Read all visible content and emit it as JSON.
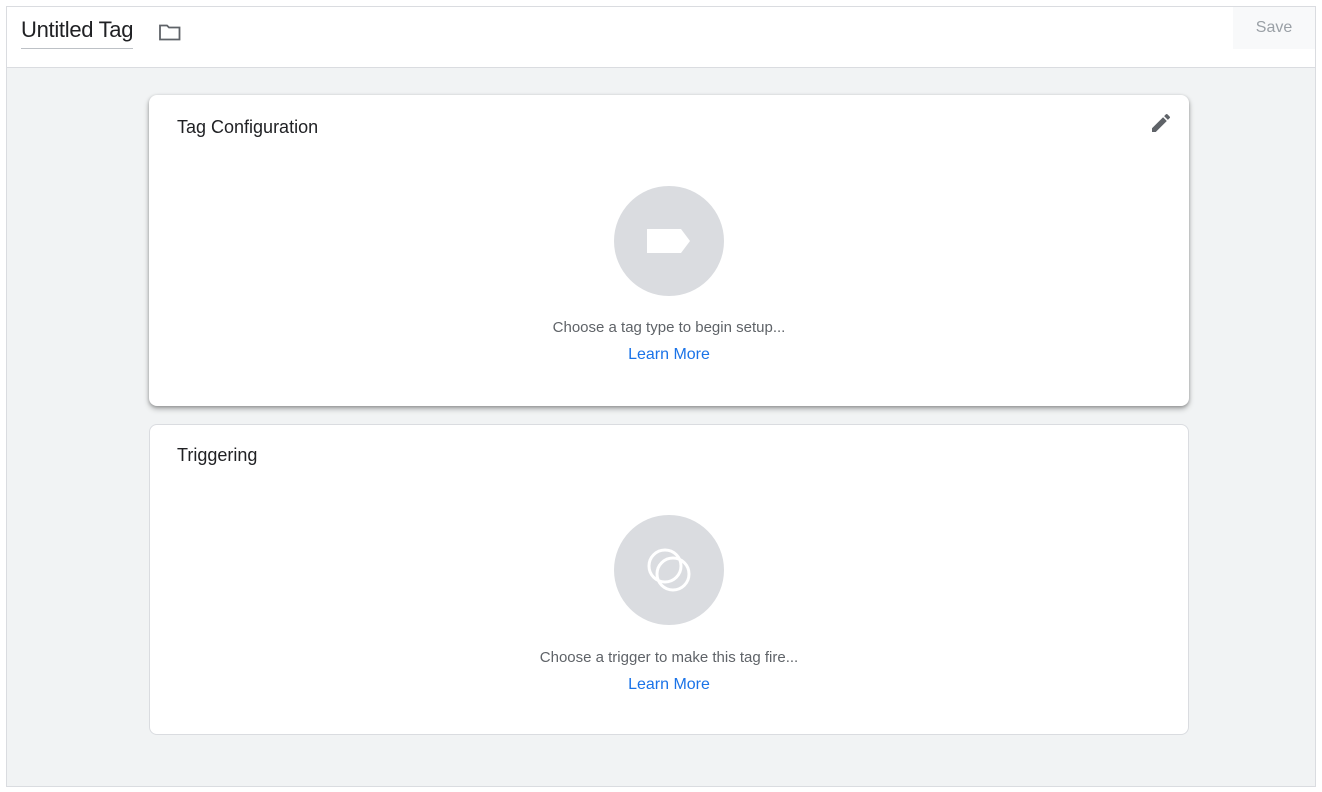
{
  "header": {
    "tag_name": "Untitled Tag",
    "folder_icon": "folder-icon",
    "save_label": "Save"
  },
  "tag_configuration": {
    "title": "Tag Configuration",
    "edit_icon": "pencil-icon",
    "placeholder_icon": "tag-icon",
    "hint": "Choose a tag type to begin setup...",
    "learn_more": "Learn More"
  },
  "triggering": {
    "title": "Triggering",
    "placeholder_icon": "trigger-icon",
    "hint": "Choose a trigger to make this tag fire...",
    "learn_more": "Learn More"
  },
  "colors": {
    "link": "#1a73e8",
    "placeholder_circle": "#dadce0",
    "background": "#f1f3f4"
  }
}
